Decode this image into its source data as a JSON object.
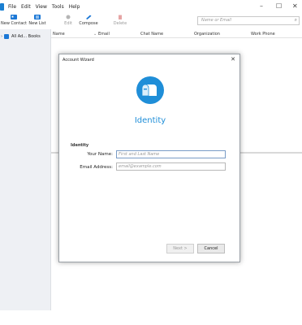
{
  "menubar": {
    "items": [
      "File",
      "Edit",
      "View",
      "Tools",
      "Help"
    ]
  },
  "window_controls": {
    "minimize": "–",
    "maximize": "☐",
    "close": "✕"
  },
  "toolbar": {
    "new_contact": "New Contact",
    "new_list": "New List",
    "edit": "Edit",
    "compose": "Compose",
    "delete": "Delete",
    "search_placeholder": "Name or Email",
    "search_icon": "⌕"
  },
  "sidebar": {
    "items": [
      {
        "label": "All Ad... Books"
      }
    ]
  },
  "columns": [
    "Name",
    "Email",
    "Chat Name",
    "Organization",
    "Work Phone"
  ],
  "dialog": {
    "title": "Account Wizard",
    "close": "✕",
    "heading": "Identity",
    "section": "Identity",
    "name_label": "Your Name:",
    "name_placeholder": "First and Last Name",
    "email_label": "Email Address:",
    "email_placeholder": "email@example.com",
    "next_label": "Next >",
    "cancel_label": "Cancel"
  },
  "colors": {
    "accent": "#1f8ed8",
    "logo": "#1f8ed8"
  }
}
